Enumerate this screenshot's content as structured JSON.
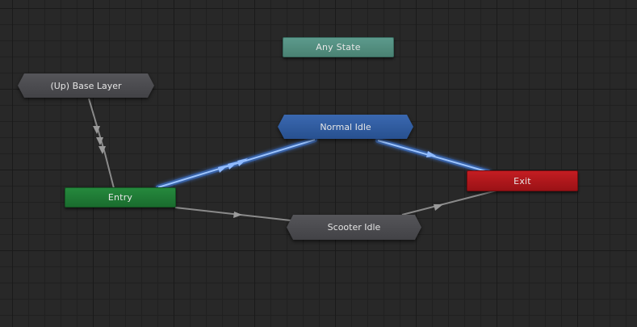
{
  "graph": {
    "nodes": {
      "any_state": {
        "label": "Any State",
        "color": "#4e8a7c"
      },
      "base_layer": {
        "label": "(Up) Base Layer",
        "color": "#4a4a4e"
      },
      "normal_idle": {
        "label": "Normal Idle",
        "color": "#2e5a9e"
      },
      "entry": {
        "label": "Entry",
        "color": "#1e7a34"
      },
      "exit": {
        "label": "Exit",
        "color": "#b0161a"
      },
      "scooter_idle": {
        "label": "Scooter Idle",
        "color": "#4a4a4e"
      }
    },
    "transitions": [
      {
        "from": "(Up) Base Layer",
        "to": "Entry",
        "highlighted": false
      },
      {
        "from": "Entry",
        "to": "Normal Idle",
        "highlighted": true
      },
      {
        "from": "Normal Idle",
        "to": "Exit",
        "highlighted": true
      },
      {
        "from": "Entry",
        "to": "Scooter Idle",
        "highlighted": false
      },
      {
        "from": "Scooter Idle",
        "to": "Exit",
        "highlighted": false
      }
    ],
    "colors": {
      "background": "#282828",
      "edge": "#8a8a8a",
      "edge_highlight": "#6ea8ff"
    }
  }
}
